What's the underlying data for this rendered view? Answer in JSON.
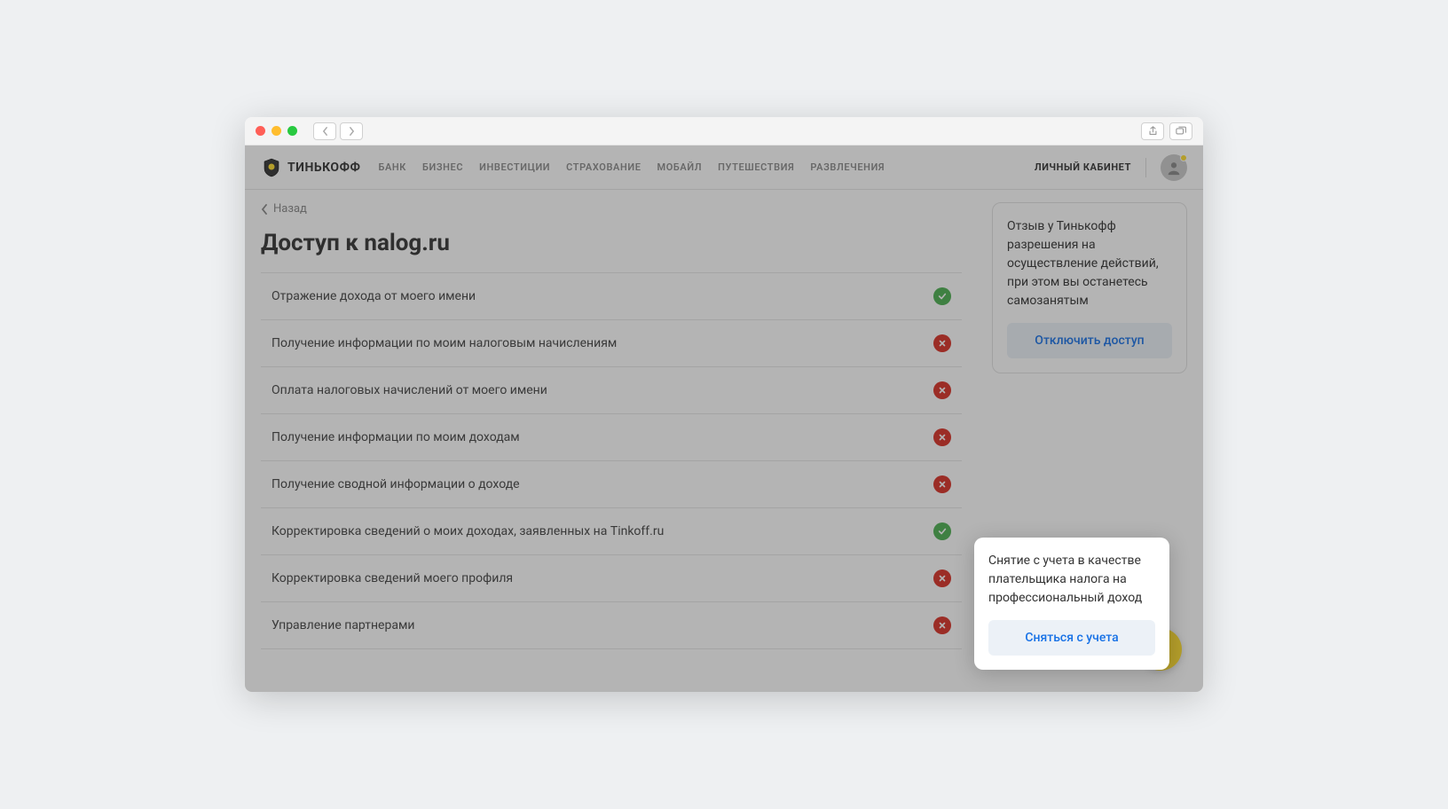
{
  "brand": "ТИНЬКОФФ",
  "nav": {
    "items": [
      "БАНК",
      "БИЗНЕС",
      "ИНВЕСТИЦИИ",
      "СТРАХОВАНИЕ",
      "МОБАЙЛ",
      "ПУТЕШЕСТВИЯ",
      "РАЗВЛЕЧЕНИЯ"
    ],
    "cabinet": "ЛИЧНЫЙ КАБИНЕТ"
  },
  "back_label": "Назад",
  "page_title": "Доступ к nalog.ru",
  "permissions": [
    {
      "label": "Отражение дохода от моего имени",
      "granted": true
    },
    {
      "label": "Получение информации по моим налоговым начислениям",
      "granted": false
    },
    {
      "label": "Оплата налоговых начислений от моего имени",
      "granted": false
    },
    {
      "label": "Получение информации по моим доходам",
      "granted": false
    },
    {
      "label": "Получение сводной информации о доходе",
      "granted": false
    },
    {
      "label": "Корректировка сведений о моих доходах, заявленных на Tinkoff.ru",
      "granted": true
    },
    {
      "label": "Корректировка сведений моего профиля",
      "granted": false
    },
    {
      "label": "Управление партнерами",
      "granted": false
    }
  ],
  "card_revoke": {
    "text": "Отзыв у Тинькофф разрешения на осуществление действий, при этом вы останетесь самозанятым",
    "button": "Отключить доступ"
  },
  "card_dereg": {
    "text": "Снятие с учета в качестве плательщика налога на профессиональный доход",
    "button": "Сняться с учета"
  }
}
